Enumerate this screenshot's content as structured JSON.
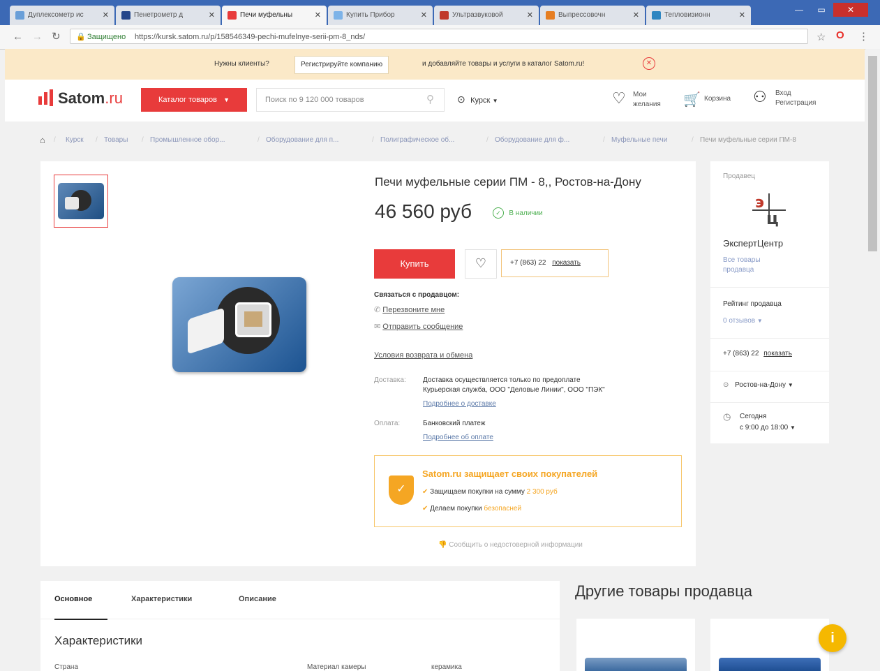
{
  "browser": {
    "tabs": [
      {
        "label": "Дуплексометр ис"
      },
      {
        "label": "Пенетрометр д"
      },
      {
        "label": "Печи муфельны"
      },
      {
        "label": "Купить Прибор"
      },
      {
        "label": "Ультразвуковой"
      },
      {
        "label": "Выпрессовочн"
      },
      {
        "label": "Тепловизионн"
      }
    ],
    "secure_label": "Защищено",
    "url": "https://kursk.satom.ru/p/158546349-pechi-mufelnye-serii-pm-8_nds/"
  },
  "promo": {
    "text_before": "Нужны клиенты?",
    "register_button": "Регистрируйте компанию",
    "text_after": "и добавляйте товары и услуги в каталог Satom.ru!"
  },
  "header": {
    "logo_main": "Satom",
    "logo_suffix": ".ru",
    "catalog_button": "Каталог товаров",
    "search_placeholder": "Поиск по 9 120 000 товаров",
    "city": "Курск",
    "wishlist": [
      "Мои",
      "желания"
    ],
    "cart": "Корзина",
    "login": "Вход",
    "register": "Регистрация"
  },
  "breadcrumbs": [
    "Курск",
    "Товары",
    "Промышленное обор...",
    "Оборудование для п...",
    "Полиграфическое об...",
    "Оборудование для ф...",
    "Муфельные печи",
    "Печи муфельные серии ПМ-8"
  ],
  "product": {
    "title": "Печи муфельные серии ПМ - 8,, Ростов-на-Дону",
    "price": "46 560 руб",
    "stock": "В наличии",
    "buy_button": "Купить",
    "phone_prefix": "+7 (863) 22",
    "phone_show": "показать",
    "contact_heading": "Связаться с продавцом:",
    "callback": "Перезвоните мне",
    "message": "Отправить сообщение",
    "return_terms": "Условия возврата и обмена",
    "delivery_label": "Доставка:",
    "delivery_text_1": "Доставка осуществляется только по предоплате",
    "delivery_text_2": "Курьерская служба, ООО \"Деловые Линии\", ООО \"ПЭК\"",
    "delivery_more": "Подробнее о доставке",
    "payment_label": "Оплата:",
    "payment_text": "Банковский платеж",
    "payment_more": "Подробнее об оплате",
    "protect_title": "Satom.ru защищает своих покупателей",
    "protect_line1_a": "Защищаем покупки на сумму",
    "protect_line1_b": "2 300 руб",
    "protect_line2_a": "Делаем покупки",
    "protect_line2_b": "безопасней",
    "report": "Сообщить о недостоверной информации"
  },
  "seller": {
    "label": "Продавец",
    "name": "ЭкспертЦентр",
    "all_products": [
      "Все товары",
      "продавца"
    ],
    "rating_label": "Рейтинг продавца",
    "reviews": "0 отзывов",
    "phone": "+7 (863) 22",
    "phone_show": "показать",
    "city": "Ростов-на-Дону",
    "hours_1": "Сегодня",
    "hours_2": "с 9:00 до 18:00"
  },
  "tabs": {
    "items": [
      "Основное",
      "Характеристики",
      "Описание"
    ],
    "section_title": "Характеристики",
    "row_left": "Страна",
    "row_right_label": "Материал камеры",
    "row_right_value": "керамика"
  },
  "other": {
    "title": "Другие товары продавца"
  },
  "colors": {
    "accent_red": "#e83b3b",
    "promo_bg": "#fbe9c8",
    "protect_orange": "#f5a623",
    "stock_green": "#4caf50",
    "link_blue": "#5b79a8"
  }
}
